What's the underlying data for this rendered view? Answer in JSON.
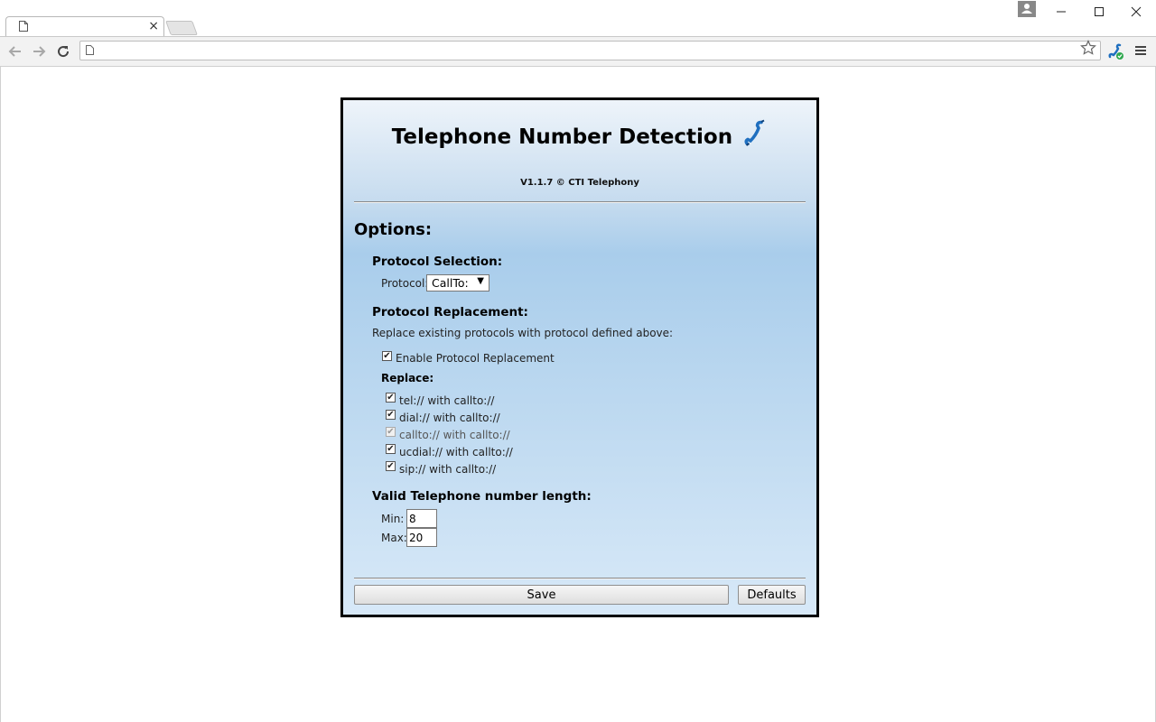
{
  "browser": {
    "tab_close": "×",
    "address_value": "",
    "window_controls": {
      "minimize": "—",
      "maximize": "☐",
      "close": "✕"
    }
  },
  "popup": {
    "title": "Telephone Number Detection",
    "version": "V1.1.7 © CTI Telephony",
    "options_heading": "Options:",
    "protocol_selection": {
      "heading": "Protocol Selection:",
      "label": "Protocol:",
      "selected": "CallTo:"
    },
    "protocol_replacement": {
      "heading": "Protocol Replacement:",
      "description": "Replace existing protocols with protocol defined above:",
      "enable_label": "Enable Protocol Replacement",
      "enable_checked": true,
      "replace_heading": "Replace:",
      "items": [
        {
          "label": "tel:// with callto://",
          "checked": true,
          "disabled": false
        },
        {
          "label": "dial:// with callto://",
          "checked": true,
          "disabled": false
        },
        {
          "label": "callto:// with callto://",
          "checked": true,
          "disabled": true
        },
        {
          "label": "ucdial:// with callto://",
          "checked": true,
          "disabled": false
        },
        {
          "label": "sip:// with callto://",
          "checked": true,
          "disabled": false
        }
      ]
    },
    "length": {
      "heading": "Valid Telephone number length:",
      "min_label": "Min:",
      "min_value": "8",
      "max_label": "Max:",
      "max_value": "20"
    },
    "buttons": {
      "save": "Save",
      "defaults": "Defaults"
    }
  },
  "colors": {
    "popup_border": "#000000",
    "popup_gradient_top": "#eef4fa",
    "popup_gradient_mid": "#a9cdeb",
    "popup_gradient_bottom": "#d8e9f8",
    "phone_icon": "#1f6fbf"
  },
  "icons": [
    "page-icon",
    "close-icon",
    "user-icon",
    "minimize-icon",
    "maximize-icon",
    "back-icon",
    "forward-icon",
    "reload-icon",
    "star-icon",
    "extension-phone-icon",
    "menu-icon",
    "phone-icon"
  ]
}
